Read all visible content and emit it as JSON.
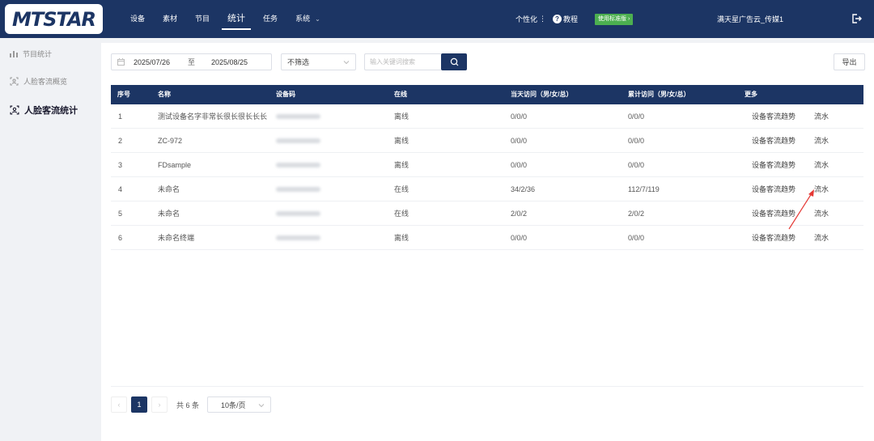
{
  "app": {
    "logo_text": "MTSTAR"
  },
  "nav": [
    {
      "label": "设备"
    },
    {
      "label": "素材"
    },
    {
      "label": "节目"
    },
    {
      "label": "统计",
      "active": true
    },
    {
      "label": "任务"
    },
    {
      "label": "系统"
    }
  ],
  "topbar": {
    "personalize": "个性化",
    "tutorial": "教程",
    "trial_badge": "使用标准版",
    "account": "满天星广告云_传媒1"
  },
  "sidebar": {
    "items": [
      {
        "label": "节目统计",
        "icon": "bar-chart-icon"
      },
      {
        "label": "人脸客流概览",
        "icon": "face-scan-icon"
      },
      {
        "label": "人脸客流统计",
        "icon": "face-scan-icon",
        "active": true
      }
    ]
  },
  "filters": {
    "date_start": "2025/07/26",
    "date_sep": "至",
    "date_end": "2025/08/25",
    "select_value": "不筛选",
    "search_placeholder": "输入关键词搜索",
    "export_label": "导出"
  },
  "table": {
    "headers": [
      "序号",
      "名称",
      "设备码",
      "在线",
      "当天访问（男/女/总）",
      "累计访问（男/女/总）",
      "更多"
    ],
    "rows": [
      {
        "index": "1",
        "name": "测试设备名字非常长很长很长长长",
        "status": "离线",
        "today": "0/0/0",
        "total": "0/0/0",
        "trend": "设备客流趋势",
        "flow": "流水"
      },
      {
        "index": "2",
        "name": "ZC-972",
        "status": "离线",
        "today": "0/0/0",
        "total": "0/0/0",
        "trend": "设备客流趋势",
        "flow": "流水"
      },
      {
        "index": "3",
        "name": "FDsample",
        "status": "离线",
        "today": "0/0/0",
        "total": "0/0/0",
        "trend": "设备客流趋势",
        "flow": "流水"
      },
      {
        "index": "4",
        "name": "未命名",
        "status": "在线",
        "today": "34/2/36",
        "total": "112/7/119",
        "trend": "设备客流趋势",
        "flow": "流水"
      },
      {
        "index": "5",
        "name": "未命名",
        "status": "在线",
        "today": "2/0/2",
        "total": "2/0/2",
        "trend": "设备客流趋势",
        "flow": "流水"
      },
      {
        "index": "6",
        "name": "未命名终端",
        "status": "离线",
        "today": "0/0/0",
        "total": "0/0/0",
        "trend": "设备客流趋势",
        "flow": "流水"
      }
    ]
  },
  "pagination": {
    "current_page": "1",
    "total_text": "共 6 条",
    "page_size": "10条/页"
  },
  "colors": {
    "primary": "#1c3564",
    "trial": "#4caf50",
    "annotation": "#e53935"
  }
}
